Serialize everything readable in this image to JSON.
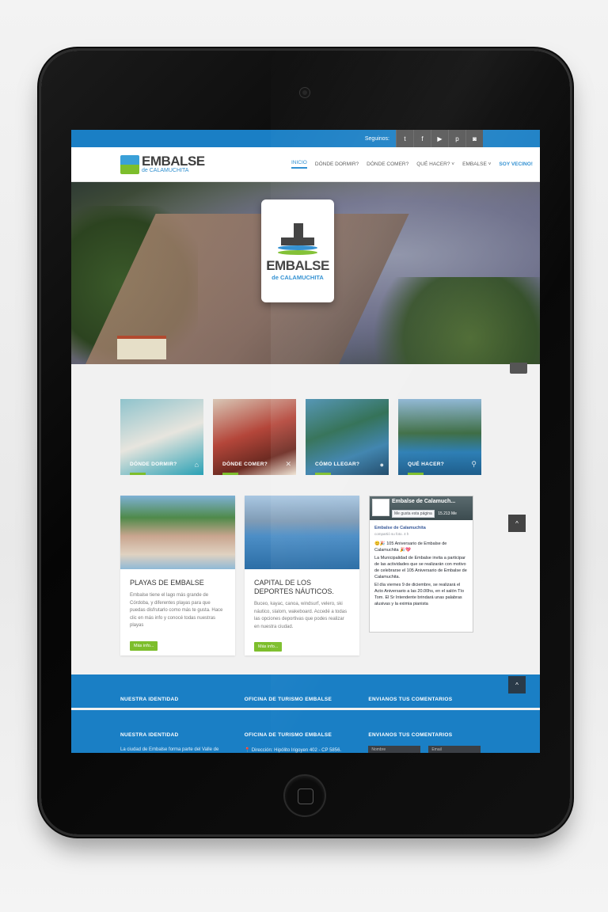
{
  "topbar": {
    "follow_label": "Seguinos:",
    "social": [
      {
        "icon": "twitter-icon",
        "glyph": "t"
      },
      {
        "icon": "facebook-icon",
        "glyph": "f"
      },
      {
        "icon": "youtube-icon",
        "glyph": "▶"
      },
      {
        "icon": "pinterest-icon",
        "glyph": "p"
      },
      {
        "icon": "instagram-icon",
        "glyph": "◙"
      }
    ]
  },
  "header": {
    "logo_big": "EMBALSE",
    "logo_small": "de CALAMUCHITA",
    "nav": [
      {
        "label": "INICIO"
      },
      {
        "label": "DÓNDE DORMIR?"
      },
      {
        "label": "DÓNDE COMER?"
      },
      {
        "label": "QUÉ HACER? ˅"
      },
      {
        "label": "EMBALSE ˅"
      },
      {
        "label": "SOY VECINO!"
      }
    ]
  },
  "hero": {
    "badge_big": "EMBALSE",
    "badge_small": "de CALAMUCHITA"
  },
  "cards": [
    {
      "label": "DÓNDE DORMIR?",
      "icon": "bed-icon",
      "glyph": "⌂"
    },
    {
      "label": "DÓNDE COMER?",
      "icon": "fork-knife-icon",
      "glyph": "✕"
    },
    {
      "label": "CÓMO LLEGAR?",
      "icon": "map-pin-icon",
      "glyph": "●"
    },
    {
      "label": "QUÉ HACER?",
      "icon": "bike-icon",
      "glyph": "⚲"
    }
  ],
  "info": [
    {
      "title": "PLAYAS DE EMBALSE",
      "text": "Embalse tiene el lago más grande de Córdoba, y diferentes playas para que puedas disfrutarlo como más te gusta. Hace clic en más info y conocé todas nuestras playas",
      "button": "Más info..."
    },
    {
      "title": "CAPITAL DE LOS DEPORTES NÁUTICOS.",
      "text": "Buceo, kayac, canoa, windsurf, velero, ski náutico, slalom, wakeboard. Accedé a todas las opciones deportivas que podes realizar en nuestra ciudad.",
      "button": "Más info..."
    }
  ],
  "facebook": {
    "page_name": "Embalse de Calamuch...",
    "like_label": "Me gusta esta página",
    "like_count": "15.213 Me",
    "post_name": "Embalse de Calamuchita",
    "post_shared_prefix": "compartió su",
    "post_shared_link": "foto.",
    "post_time": "4 h",
    "post_lines": [
      "😊🎉 105 Aniversario de Embalse de Calamuchita 🎉💖",
      "La Municipalidad de Embalse invita a participar de las actividades que se realizarán con motivo de celebrarse el 105 Aniversario de Embalse de Calamuchita.",
      "El día viernes 9 de diciembre, se realizará el Acto Aniversario a las 20.00hs, en el salón Tío Tom. El Sr Intendente brindará unas palabras alusivas y la eximia pianista"
    ]
  },
  "footer": {
    "col1": "NUESTRA IDENTIDAD",
    "col2": "OFICINA DE TURISMO EMBALSE",
    "col3": "ENVIANOS TUS COMENTARIOS",
    "col1_text": "La ciudad de Embalse forma parte del Valle de",
    "col2_text": "📍 Dirección: Hipólito Irigoyen 402 - CP 5856.",
    "field1": "Nombre",
    "field2": "Email"
  },
  "to_top_glyph": "^"
}
